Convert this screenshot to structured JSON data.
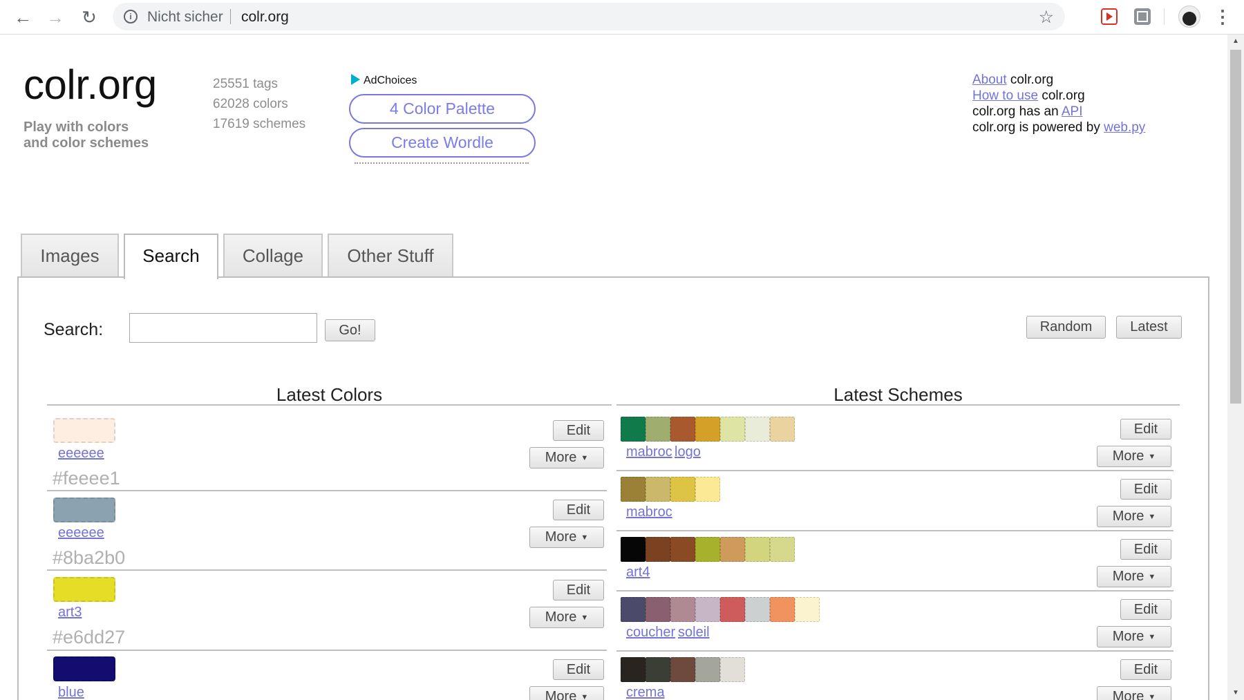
{
  "browser": {
    "security_label": "Nicht sicher",
    "url": "colr.org",
    "back_icon": "arrow-left",
    "forward_icon": "arrow-right",
    "reload_icon": "reload",
    "star_icon": "star",
    "menu_icon": "vertical-dots"
  },
  "header": {
    "logo": "colr.org",
    "tagline_line1": "Play with colors",
    "tagline_line2": "and color schemes",
    "stats": [
      "25551 tags",
      "62028 colors",
      "17619 schemes"
    ],
    "adchoices": "AdChoices",
    "ad_buttons": [
      "4 Color Palette",
      "Create Wordle"
    ]
  },
  "info": {
    "about_link": "About",
    "about_text": " colr.org",
    "howto_link": "How to use",
    "howto_text": " colr.org",
    "api_text": "colr.org has an ",
    "api_link": "API",
    "powered_text": "colr.org is powered by ",
    "powered_link": "web.py"
  },
  "tabs": [
    "Images",
    "Search",
    "Collage",
    "Other Stuff"
  ],
  "active_tab": "Search",
  "search": {
    "label": "Search:",
    "value": "",
    "go_label": "Go!",
    "random_label": "Random",
    "latest_label": "Latest"
  },
  "latest_colors": {
    "title": "Latest Colors",
    "items": [
      {
        "color": "#feeee1",
        "tag": "eeeeee",
        "hex": "#feeee1"
      },
      {
        "color": "#8ba2b0",
        "tag": "eeeeee",
        "hex": "#8ba2b0"
      },
      {
        "color": "#e6dd27",
        "tag": "art3",
        "hex": "#e6dd27"
      },
      {
        "color": "#120d6e",
        "tag": "blue",
        "hex": ""
      }
    ]
  },
  "latest_schemes": {
    "title": "Latest Schemes",
    "items": [
      {
        "colors": [
          "#117a4a",
          "#9fae6e",
          "#a85a2e",
          "#d4a028",
          "#dde4a4",
          "#e9ecd8",
          "#ebd3a0"
        ],
        "tags": [
          "mabroc",
          "logo"
        ]
      },
      {
        "colors": [
          "#9a8137",
          "#cbb86a",
          "#ddc444",
          "#fbe996"
        ],
        "tags": [
          "mabroc"
        ]
      },
      {
        "colors": [
          "#060606",
          "#7a4220",
          "#8a4a24",
          "#a7b12c",
          "#cf9b5a",
          "#d2d47e",
          "#d6d98c"
        ],
        "tags": [
          "art4"
        ]
      },
      {
        "colors": [
          "#4c4a6a",
          "#8a6070",
          "#b08a92",
          "#c6b6c6",
          "#cf5c5c",
          "#ccd0d0",
          "#f0935e",
          "#fbf3d0"
        ],
        "tags": [
          "coucher",
          "soleil"
        ]
      },
      {
        "colors": [
          "#2a2420",
          "#3a3e34",
          "#6e4a3e",
          "#a4a69c",
          "#e2dfd8"
        ],
        "tags": [
          "crema"
        ]
      }
    ]
  },
  "labels": {
    "edit": "Edit",
    "more": "More",
    "more_caret": "▼"
  }
}
